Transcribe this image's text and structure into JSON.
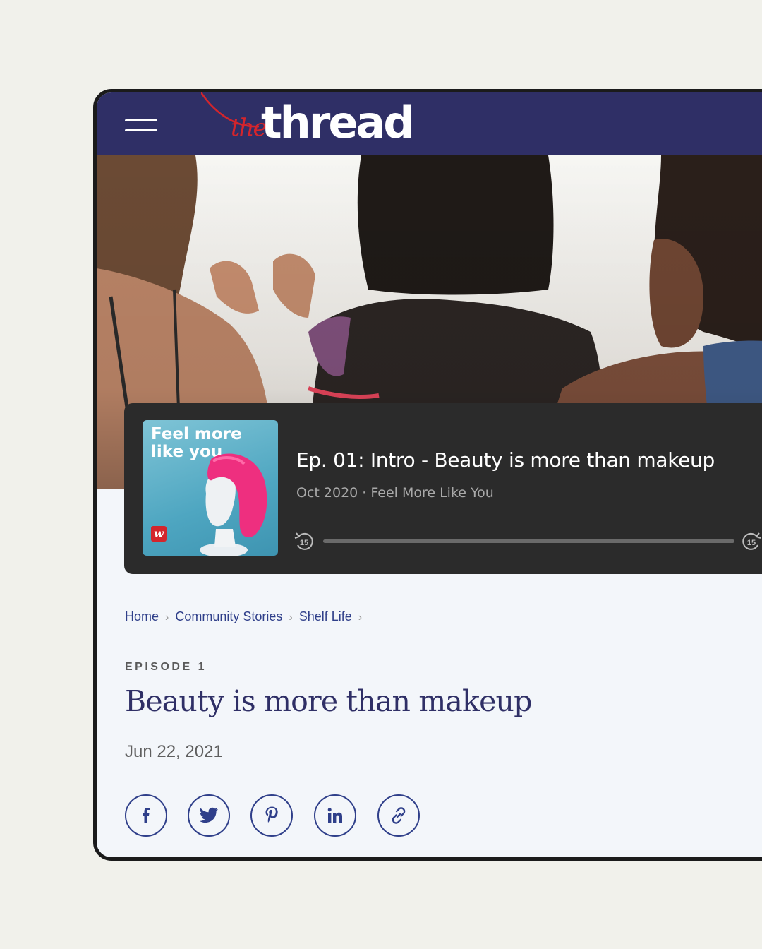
{
  "header": {
    "logo_the": "the",
    "logo_thread": "thread",
    "menu_icon": "hamburger-menu-icon"
  },
  "player": {
    "cover": {
      "text": "Feel more like you",
      "badge": "w"
    },
    "episode_title": "Ep. 01: Intro - Beauty is more than makeup",
    "meta": "Oct 2020 · Feel More Like You",
    "skip_back_icon": "rewind-15-icon",
    "skip_forward_icon": "forward-15-icon",
    "skip_seconds": "15",
    "progress": 0
  },
  "breadcrumb": {
    "items": [
      "Home",
      "Community Stories",
      "Shelf Life"
    ],
    "separator": "›"
  },
  "article": {
    "kicker": "EPISODE 1",
    "title": "Beauty is more than makeup",
    "date": "Jun 22, 2021"
  },
  "share": {
    "icons": [
      "facebook-icon",
      "twitter-icon",
      "pinterest-icon",
      "linkedin-icon",
      "copy-link-icon"
    ]
  },
  "colors": {
    "navy": "#2f2f66",
    "link": "#2f3f8a",
    "brand_red": "#d4252c",
    "player_bg": "#2b2b2b"
  }
}
